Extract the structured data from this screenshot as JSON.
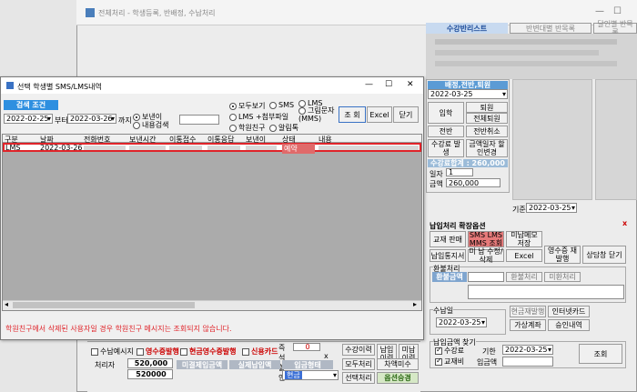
{
  "bg_window": {
    "title": "전체처리 - 학생등록, 반배정, 수납처리",
    "tabs": [
      "수강반리스트",
      "반변대별 반목록",
      "달인별 반목록"
    ],
    "assign_header": "배정,전반,퇴원",
    "assign_date": "2022-03-25",
    "assign_buttons": [
      "입학",
      "퇴원",
      "전체퇴원",
      "전반",
      "전반취소",
      "수강료 발생",
      "금액일자 할인변경"
    ],
    "fee_label": "수강료합계 : 260,000",
    "days_label": "일자",
    "days_value": "1",
    "amount_label": "금액",
    "amount_value": "260,000",
    "base_date_label": "기준",
    "base_date": "2022-03-25",
    "pay_title": "납입처리 확장옵션",
    "pay_buttons": [
      "교재 판매",
      "SMS LMS MMS 조회",
      "미납메모 저장",
      "납입통지서",
      "미 납 수정/삭제",
      "Excel",
      "영수증 재발행",
      "상담창 닫기"
    ],
    "refund_group": "환불처리",
    "refund_amount_label": "환불금액",
    "refund_btn": "환불처리",
    "unpaid_btn": "미환처리",
    "pay_day_group": "수납일",
    "pay_date": "2022-03-25",
    "cash_receipt_btn": "현금재발행",
    "internet_card_btn": "인터넷카드",
    "virtual_account_btn": "가상계좌",
    "approval_btn": "승인내역",
    "search_group": "납입금액 찾기",
    "tuition_check": "수강료",
    "textbook_check": "교재비",
    "period_label": "기한",
    "period_date": "2022-03-25",
    "deposit_label": "입금액",
    "search_btn": "조회",
    "bottom_checks": [
      "수납예시지",
      "영수증발행",
      "현금영수증발행",
      "신용카드"
    ],
    "process_label": "처리자",
    "amount1": "520,000",
    "amount2": "520000",
    "cols": [
      "미결제입금액",
      "실제납입액",
      "입금형태"
    ],
    "pay_type": "현금",
    "x_label": "x",
    "discount_label": "즉석 할인",
    "discount_value": "0",
    "history_btn": "수강이력",
    "b_btn1": "납입 이력",
    "b_btn2": "미납 이력",
    "all_unpaid_btn": "모두처리",
    "diff_unpaid_btn": "차액미수",
    "selected_process_btn": "선택처리",
    "option_change_btn": "옵션승경",
    "close_x": "x"
  },
  "dialog": {
    "title": "선택 학생별 SMS/LMS내역",
    "controls": [
      "—",
      "☐",
      "✕"
    ],
    "search_label": "검색 조건",
    "date_from": "2022-02-25",
    "from_suffix": "부터",
    "date_to": "2022-03-26",
    "to_suffix": "까지",
    "radio_sent": "보낸이",
    "radio_content": "내용검색",
    "radio_all": "모두보기",
    "radio_sms": "SMS",
    "radio_lms": "LMS",
    "radio_lms_file": "LMS +첨부파일",
    "radio_group": "그림문자 (MMS)",
    "radio_parent": "학원친구",
    "radio_alert": "알림톡",
    "btn_search": "조 회",
    "btn_excel": "Excel",
    "btn_close": "닫기",
    "columns": [
      "구분",
      "날짜",
      "전화번호",
      "보낸시간",
      "이통접수",
      "이통응답",
      "보낸이",
      "상태",
      "내용"
    ],
    "rows": [
      {
        "type": "LMS",
        "date": "2022-03-26",
        "phone": "",
        "time": "",
        "recv": "",
        "resp": "",
        "sender": "",
        "status": "예약",
        "content": ""
      }
    ],
    "warning": "학원친구에서 삭제된 사용자일 경우 학원친구 메시지는 조회되지 않습니다."
  }
}
